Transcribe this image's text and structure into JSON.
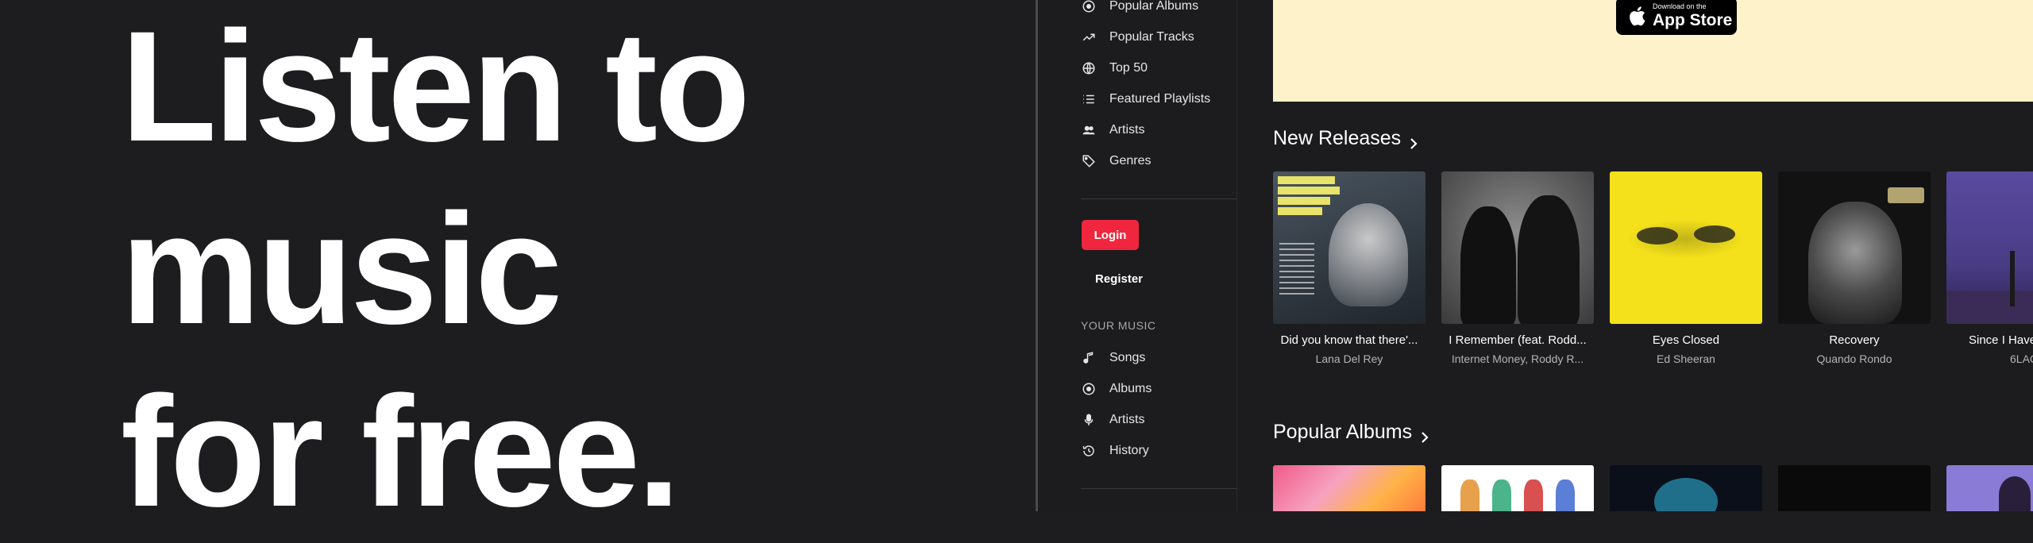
{
  "hero": {
    "line1": "Listen to",
    "line2": "music",
    "line3": "for free."
  },
  "sidebar": {
    "nav": [
      {
        "label": "Popular Albums",
        "icon": "disc-icon"
      },
      {
        "label": "Popular Tracks",
        "icon": "trending-icon"
      },
      {
        "label": "Top 50",
        "icon": "globe-icon"
      },
      {
        "label": "Featured Playlists",
        "icon": "list-icon"
      },
      {
        "label": "Artists",
        "icon": "people-icon"
      },
      {
        "label": "Genres",
        "icon": "tag-icon"
      }
    ],
    "login_label": "Login",
    "register_label": "Register",
    "your_music_label": "YOUR MUSIC",
    "your_music": [
      {
        "label": "Songs",
        "icon": "music-note-icon"
      },
      {
        "label": "Albums",
        "icon": "disc-icon"
      },
      {
        "label": "Artists",
        "icon": "microphone-icon"
      },
      {
        "label": "History",
        "icon": "history-icon"
      }
    ]
  },
  "promo": {
    "app_store_small": "Download on the",
    "app_store_big": "App Store"
  },
  "new_releases": {
    "title": "New Releases",
    "items": [
      {
        "title": "Did you know that there'...",
        "artist": "Lana Del Rey"
      },
      {
        "title": "I Remember (feat. Rodd...",
        "artist": "Internet Money, Roddy R..."
      },
      {
        "title": "Eyes Closed",
        "artist": "Ed Sheeran"
      },
      {
        "title": "Recovery",
        "artist": "Quando Rondo"
      },
      {
        "title": "Since I Have",
        "artist": "6LAC"
      }
    ]
  },
  "popular_albums": {
    "title": "Popular Albums"
  },
  "colors": {
    "background": "#1d1d1f",
    "accent": "#f0263f",
    "promo_bg": "#fdf2c9"
  }
}
